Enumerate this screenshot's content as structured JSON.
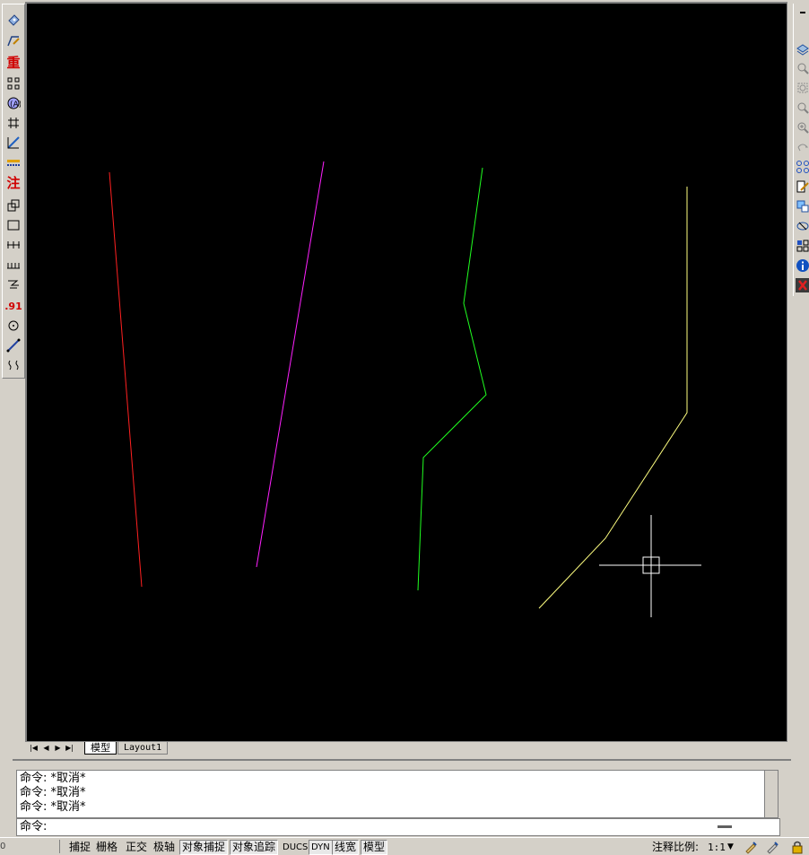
{
  "colors": {
    "canvas_bg": "#000000",
    "line_red": "#ff2020",
    "line_magenta": "#ff20ff",
    "line_green": "#20ff20",
    "line_yellow": "#ffff80",
    "crosshair": "#ffffff"
  },
  "left_toolbar": {
    "icons": [
      "dimstyle-icon",
      "dimension-edit-icon",
      "multiline-text-icon",
      "linear-dimension-icon",
      "aligned-dimension-icon",
      "arc-length-icon",
      "ordinate-dimension-icon",
      "radius-dimension-icon",
      "annotation-text-icon",
      "baseline-dimension-icon",
      "rectangle-icon",
      "continue-dimension-icon",
      "quick-dimension-icon",
      "leader-icon",
      "tolerance-icon",
      "center-mark-icon",
      "jogged-dimension-icon",
      "break-dimension-icon"
    ],
    "text_labels": {
      "redo": "重",
      "annotate": "注",
      "decimal": ".91"
    }
  },
  "right_toolbar": {
    "icons": [
      "layers-icon",
      "zoom-realtime-icon",
      "zoom-window-icon",
      "zoom-previous-icon",
      "zoom-extents-icon",
      "pan-icon",
      "group-icon",
      "match-properties-icon",
      "xref-icon",
      "orbit-icon",
      "block-editor-icon",
      "info-icon",
      "close-icon"
    ]
  },
  "tabs": {
    "model": "模型",
    "layout1": "Layout1"
  },
  "command": {
    "history": [
      "命令: *取消*",
      "命令: *取消*",
      "命令: *取消*"
    ],
    "prompt": "命令:"
  },
  "status_bar": {
    "coords": "0",
    "buttons": [
      {
        "label": "捕捉",
        "on": false
      },
      {
        "label": "栅格",
        "on": false
      },
      {
        "label": "正交",
        "on": false
      },
      {
        "label": "极轴",
        "on": false
      },
      {
        "label": "对象捕捉",
        "on": true
      },
      {
        "label": "对象追踪",
        "on": true
      },
      {
        "label": "DUCS",
        "on": false
      },
      {
        "label": "DYN",
        "on": true
      },
      {
        "label": "线宽",
        "on": true
      },
      {
        "label": "模型",
        "on": true
      }
    ],
    "annotation_scale_label": "注释比例:",
    "annotation_scale_value": "1:1"
  }
}
